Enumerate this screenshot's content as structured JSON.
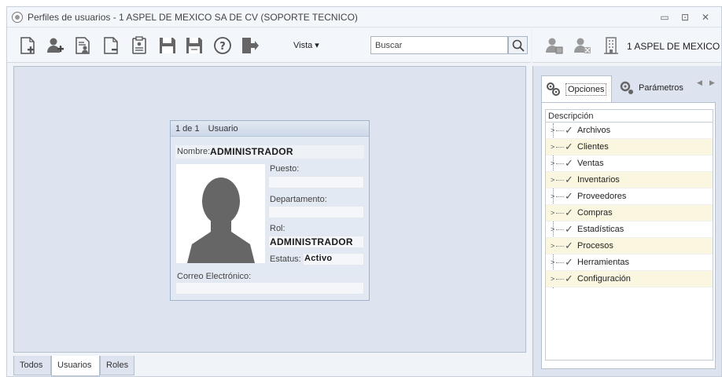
{
  "window": {
    "title": "Perfiles de usuarios - 1 ASPEL DE MEXICO SA DE CV (SOPORTE TECNICO)"
  },
  "toolbar": {
    "icons": [
      "new-document-icon",
      "add-user-icon",
      "user-report-icon",
      "blank-document-icon",
      "clipboard-icon",
      "save-icon",
      "save-as-icon",
      "help-icon",
      "exit-icon"
    ],
    "vista_label": "Vista ▾",
    "search_placeholder": "Buscar"
  },
  "right_toolbar": {
    "icons": [
      "user-edit-icon",
      "user-delete-icon",
      "building-icon"
    ],
    "company_label": "1 ASPEL DE MEXICO ..."
  },
  "user_card": {
    "counter": "1 de 1",
    "header_label": "Usuario",
    "nombre_label": "Nombre:",
    "nombre_value": "ADMINISTRADOR",
    "puesto_label": "Puesto:",
    "puesto_value": "",
    "departamento_label": "Departamento:",
    "departamento_value": "",
    "rol_label": "Rol:",
    "rol_value": "ADMINISTRADOR",
    "estatus_label": "Estatus:",
    "estatus_value": "Activo",
    "correo_label": "Correo Electrónico:",
    "correo_value": ""
  },
  "bottom_tabs": [
    {
      "label": "Todos",
      "active": false
    },
    {
      "label": "Usuarios",
      "active": true
    },
    {
      "label": "Roles",
      "active": false
    }
  ],
  "right_panel": {
    "tabs": [
      {
        "label": "Opciones",
        "active": true
      },
      {
        "label": "Parámetros",
        "active": false
      }
    ],
    "tree_header": "Descripción",
    "tree_items": [
      "Archivos",
      "Clientes",
      "Ventas",
      "Inventarios",
      "Proveedores",
      "Compras",
      "Estadísticas",
      "Procesos",
      "Herramientas",
      "Configuración"
    ]
  },
  "colors": {
    "workspace": "#dde4ef",
    "card_border": "#9fb2cc",
    "row_highlight": "#fbf6df"
  }
}
